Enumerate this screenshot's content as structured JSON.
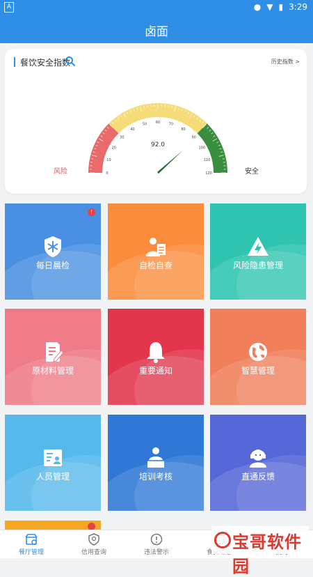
{
  "status_bar": {
    "time": "3:29",
    "left_badge": "A"
  },
  "header": {
    "title": "卤面"
  },
  "safety_card": {
    "title": "餐饮安全指数",
    "history_link": "历史指数 >",
    "value": "92.0",
    "risk_label": "风险",
    "safe_label": "安全",
    "gauge_min": 0,
    "gauge_max": 120,
    "gauge_ticks": [
      "0",
      "10",
      "20",
      "30",
      "40",
      "50",
      "60",
      "70",
      "80",
      "90",
      "100",
      "110",
      "120"
    ],
    "colors": {
      "risk": "#e86a6a",
      "mid": "#f5dc79",
      "safe": "#3a8f3e"
    }
  },
  "tiles": [
    {
      "label": "每日晨检",
      "icon": "snowflake-shield-icon",
      "color": "#4a90e2",
      "badge": "!"
    },
    {
      "label": "自检自查",
      "icon": "person-checklist-icon",
      "color": "#fb8c3c"
    },
    {
      "label": "风险隐患管理",
      "icon": "warning-bolt-icon",
      "color": "#2ec4b0"
    },
    {
      "label": "原材料管理",
      "icon": "document-pen-icon",
      "color": "#ee7b87"
    },
    {
      "label": "重要通知",
      "icon": "bell-icon",
      "color": "#e2364d"
    },
    {
      "label": "智慧管理",
      "icon": "globe-icon",
      "color": "#f07f5a"
    },
    {
      "label": "人员管理",
      "icon": "id-card-icon",
      "color": "#56b9ec"
    },
    {
      "label": "培训考核",
      "icon": "teacher-icon",
      "color": "#2f78d6"
    },
    {
      "label": "直通反馈",
      "icon": "support-agent-icon",
      "color": "#5667d8"
    }
  ],
  "tabbar": [
    {
      "label": "餐厅管理",
      "icon": "restaurant-icon",
      "active": true
    },
    {
      "label": "信用查询",
      "icon": "shield-icon"
    },
    {
      "label": "违法警示",
      "icon": "warning-circle-icon"
    },
    {
      "label": "食安动态",
      "icon": "news-icon"
    },
    {
      "label": "我的",
      "icon": "user-icon"
    }
  ],
  "watermark": {
    "text": "宝哥软件园"
  }
}
